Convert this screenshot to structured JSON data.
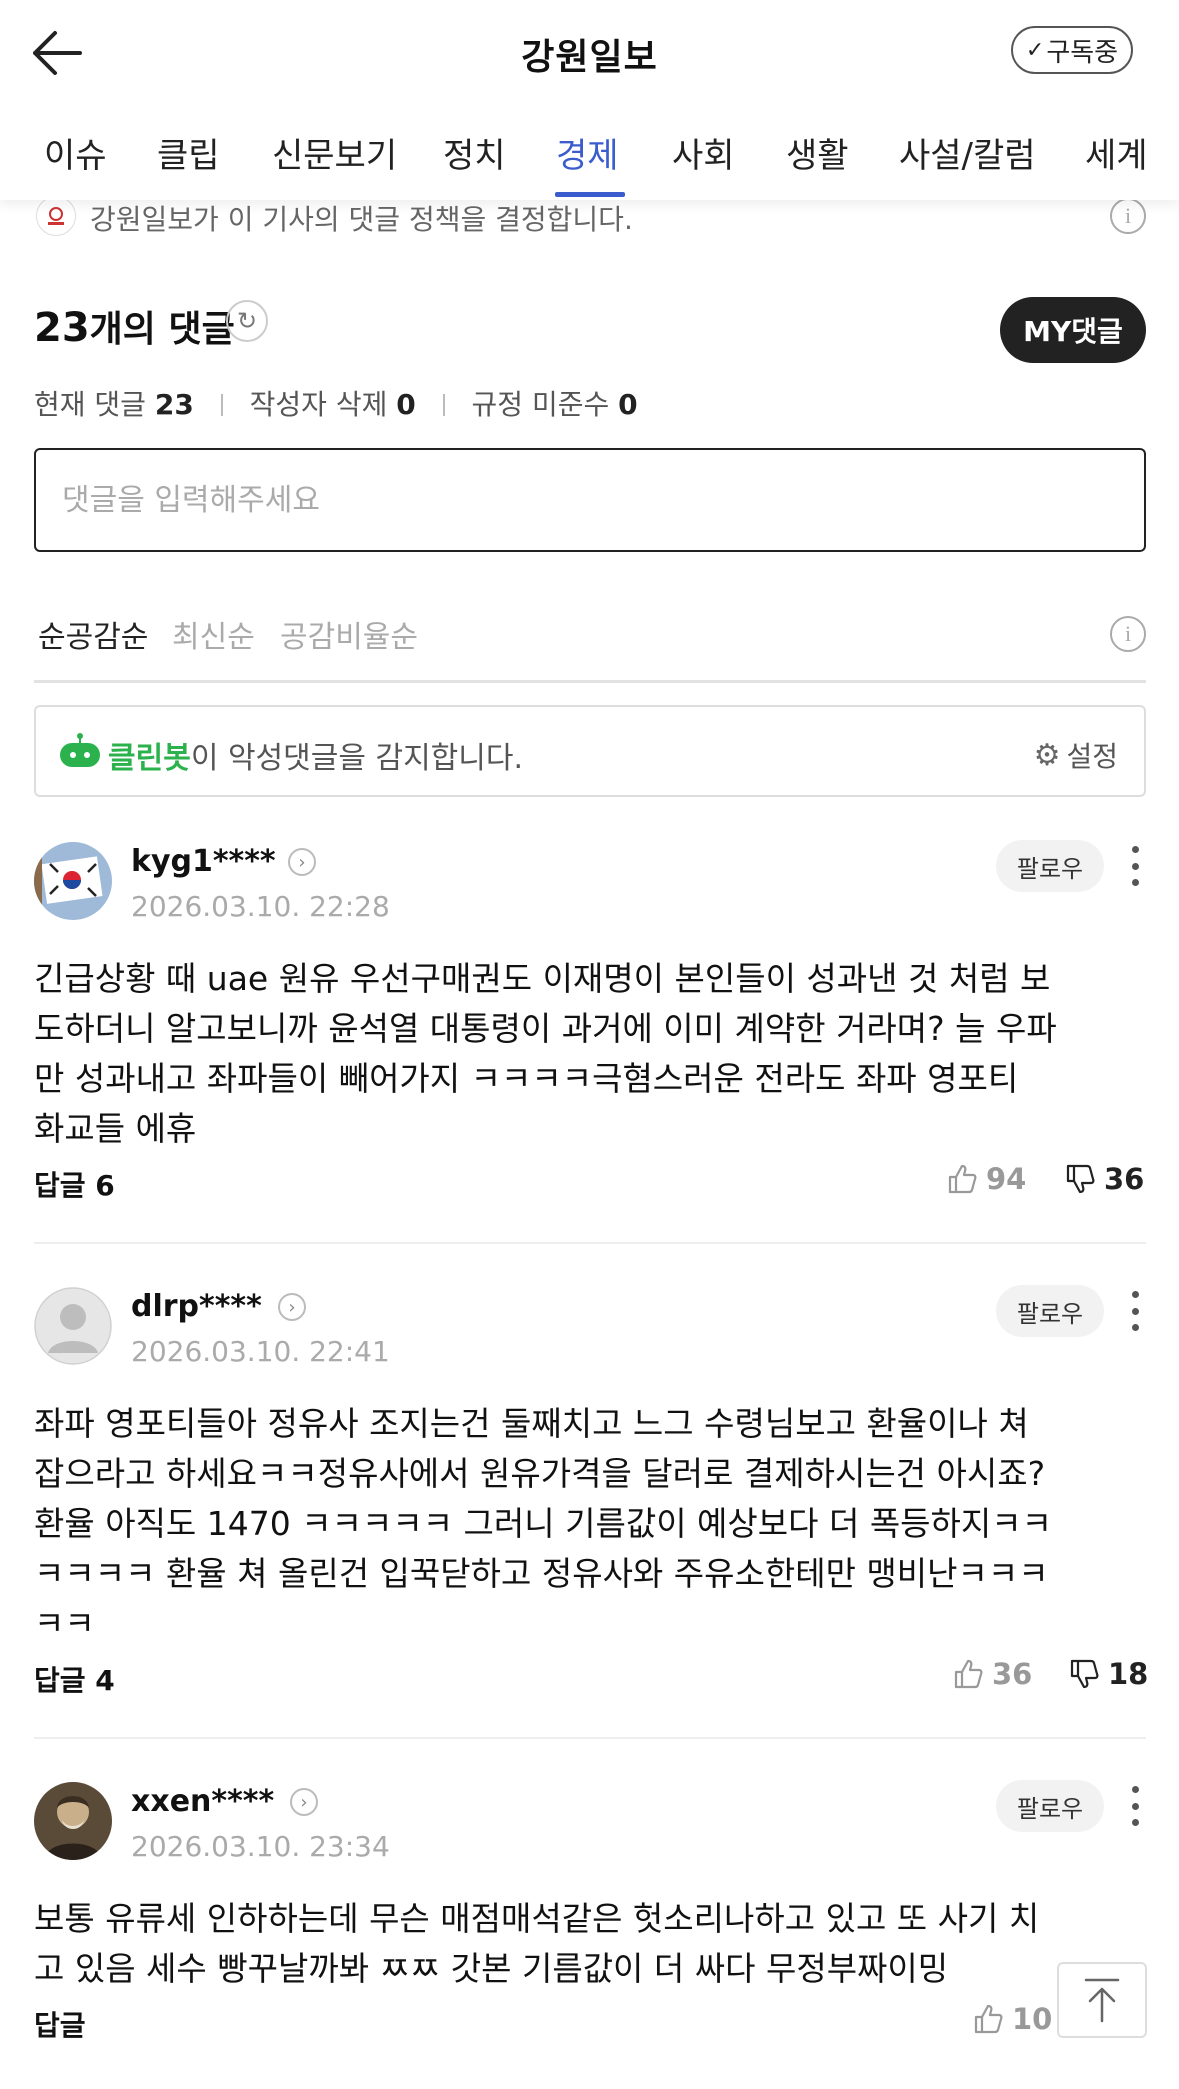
{
  "header": {
    "title": "강원일보",
    "subscribe_label": "구독중",
    "tabs": [
      "이슈",
      "클립",
      "신문보기",
      "정치",
      "경제",
      "사회",
      "생활",
      "사설/칼럼",
      "세계"
    ],
    "active_tab": "경제"
  },
  "policy": {
    "text": "강원일보가 이 기사의 댓글 정책을 결정합니다."
  },
  "comments_header": {
    "count": "23",
    "count_suffix": "개의 댓글",
    "my_button": "MY댓글",
    "stats": [
      {
        "label": "현재 댓글",
        "value": "23"
      },
      {
        "label": "작성자 삭제",
        "value": "0"
      },
      {
        "label": "규정 미준수",
        "value": "0"
      }
    ],
    "input_placeholder": "댓글을 입력해주세요",
    "sort_options": [
      "순공감순",
      "최신순",
      "공감비율순"
    ],
    "active_sort": "순공감순"
  },
  "cleanbot": {
    "name": "클린봇",
    "text": "이 악성댓글을 감지합니다.",
    "settings_label": "설정"
  },
  "comments": [
    {
      "username": "kyg1****",
      "date": "2026.03.10. 22:28",
      "follow_label": "팔로우",
      "text": "긴급상황 때 uae 원유 우선구매권도 이재명이 본인들이 성과낸 것 처럼 보\n도하더니 알고보니까 윤석열 대통령이 과거에 이미 계약한 거라며? 늘 우파\n만 성과내고 좌파들이 빼어가지 ㅋㅋㅋㅋ극혐스러운 전라도 좌파 영포티\n화교들 에휴",
      "reply_label": "답글",
      "reply_count": "6",
      "likes": "94",
      "dislikes": "36"
    },
    {
      "username": "dlrp****",
      "date": "2026.03.10. 22:41",
      "follow_label": "팔로우",
      "text": "좌파 영포티들아 정유사 조지는건 둘째치고 느그 수령님보고 환율이나 쳐\n잡으라고 하세요ㅋㅋ정유사에서 원유가격을 달러로 결제하시는건 아시죠?\n환율 아직도 1470 ㅋㅋㅋㅋㅋ 그러니 기름값이 예상보다 더 폭등하지ㅋㅋ\nㅋㅋㅋㅋ 환율 쳐 올린건 입꾹닫하고 정유사와 주유소한테만 맹비난ㅋㅋㅋ\nㅋㅋ",
      "reply_label": "답글",
      "reply_count": "4",
      "likes": "36",
      "dislikes": "18"
    },
    {
      "username": "xxen****",
      "date": "2026.03.10. 23:34",
      "follow_label": "팔로우",
      "text": "보통 유류세 인하하는데 무슨 매점매석같은 헛소리나하고 있고 또 사기 치\n고 있음 세수 빵꾸날까봐 ㅉㅉ 갓본 기름값이 더 싸다 무정부짜이밍",
      "reply_label": "답글",
      "reply_count": "",
      "likes": "10",
      "dislikes": ""
    }
  ],
  "icons": {
    "back": "back-arrow-icon",
    "check": "check-icon",
    "refresh": "refresh-icon",
    "info": "info-icon",
    "cleanbot": "robot-icon",
    "gear": "gear-icon",
    "like": "thumbs-up-icon",
    "dislike": "thumbs-down-icon",
    "more": "more-vertical-icon",
    "scroll_top": "arrow-up-icon"
  },
  "colors": {
    "accent": "#3b5ccc",
    "cleanbot_green": "#2bb24c",
    "dark_button": "#222222"
  }
}
